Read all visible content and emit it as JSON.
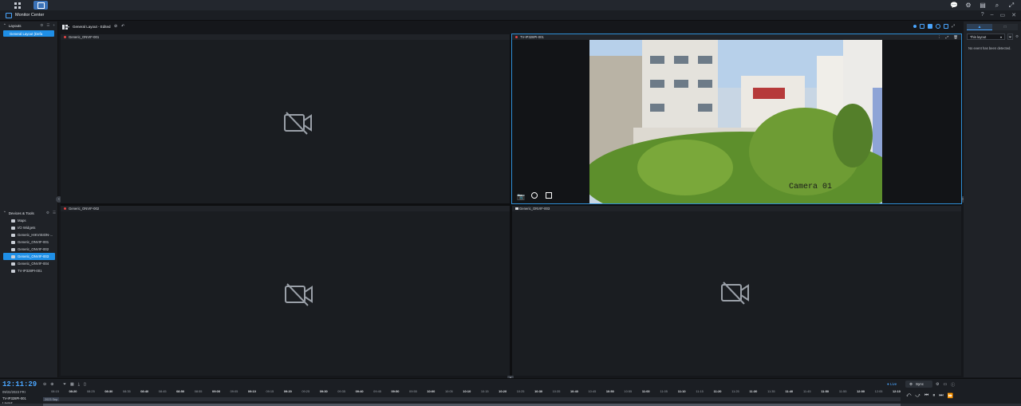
{
  "app": {
    "title": "Monitor Center"
  },
  "topbar": {
    "right_icons": [
      "chat-icon",
      "options-icon",
      "widgets-icon",
      "search-icon",
      "expand-icon"
    ]
  },
  "window_controls": [
    "?",
    "–",
    "▭",
    "✕"
  ],
  "left_panel": {
    "layouts_header": "Layouts",
    "layouts": [
      {
        "label": "General Layout (Defa"
      }
    ],
    "devices_header": "Devices & Tools",
    "devices": [
      {
        "label": "Maps",
        "icon": "map-icon"
      },
      {
        "label": "I/O Widgets",
        "icon": "lock-icon"
      },
      {
        "label": "Generic_HIKVISION-...",
        "icon": "camera-icon"
      },
      {
        "label": "Generic_ONVIF-001",
        "icon": "camera-icon"
      },
      {
        "label": "Generic_ONVIF-002",
        "icon": "camera-icon"
      },
      {
        "label": "Generic_ONVIF-003",
        "icon": "camera-icon",
        "selected": true
      },
      {
        "label": "Generic_ONVIF-004",
        "icon": "camera-icon"
      },
      {
        "label": "TV-IP328PI-001",
        "icon": "camera-icon"
      }
    ]
  },
  "toolbar": {
    "layout_name": "General Layout - Edited"
  },
  "cells": [
    {
      "name": "Generic_ONVIF-001",
      "status": "error",
      "feed": "none"
    },
    {
      "name": "TV-IP328PI-001",
      "status": "error",
      "feed": "live",
      "selected": true,
      "overlay_text": "Camera 01"
    },
    {
      "name": "Generic_ONVIF-002",
      "status": "error",
      "feed": "none"
    },
    {
      "name": "Generic_ONVIF-003",
      "status": "recording",
      "feed": "none"
    }
  ],
  "right_panel": {
    "filter": "This layout",
    "empty_message": "No event has been detected."
  },
  "bottom": {
    "time": "12:11:29",
    "date": "09/22/2023 FRI",
    "camera": "TV-IP328PI-001",
    "layout": "Layout",
    "live": "● Live",
    "sync": "Sync",
    "track_label": "2023 Sep",
    "ticks": [
      "08:15",
      "08:20",
      "08:25",
      "08:30",
      "08:35",
      "08:40",
      "08:45",
      "08:50",
      "08:55",
      "09:00",
      "09:05",
      "09:10",
      "09:15",
      "09:20",
      "09:25",
      "09:30",
      "09:35",
      "09:40",
      "09:45",
      "09:50",
      "09:55",
      "10:00",
      "10:05",
      "10:10",
      "10:15",
      "10:20",
      "10:25",
      "10:30",
      "10:35",
      "10:40",
      "10:45",
      "10:50",
      "10:55",
      "11:00",
      "11:05",
      "11:10",
      "11:15",
      "11:20",
      "11:25",
      "11:30",
      "11:35",
      "11:40",
      "11:45",
      "11:50",
      "11:55",
      "12:00",
      "12:05",
      "12:10"
    ],
    "major_ticks": [
      "08:20",
      "08:30",
      "08:40",
      "08:50",
      "09:00",
      "09:10",
      "09:20",
      "09:30",
      "09:40",
      "09:50",
      "10:00",
      "10:10",
      "10:20",
      "10:30",
      "10:40",
      "10:50",
      "11:00",
      "11:10",
      "11:20",
      "11:30",
      "11:40",
      "11:50",
      "12:00",
      "12:10"
    ]
  },
  "colors": {
    "accent": "#1f8fe6",
    "error": "#e14444",
    "panel": "#1f2227"
  }
}
